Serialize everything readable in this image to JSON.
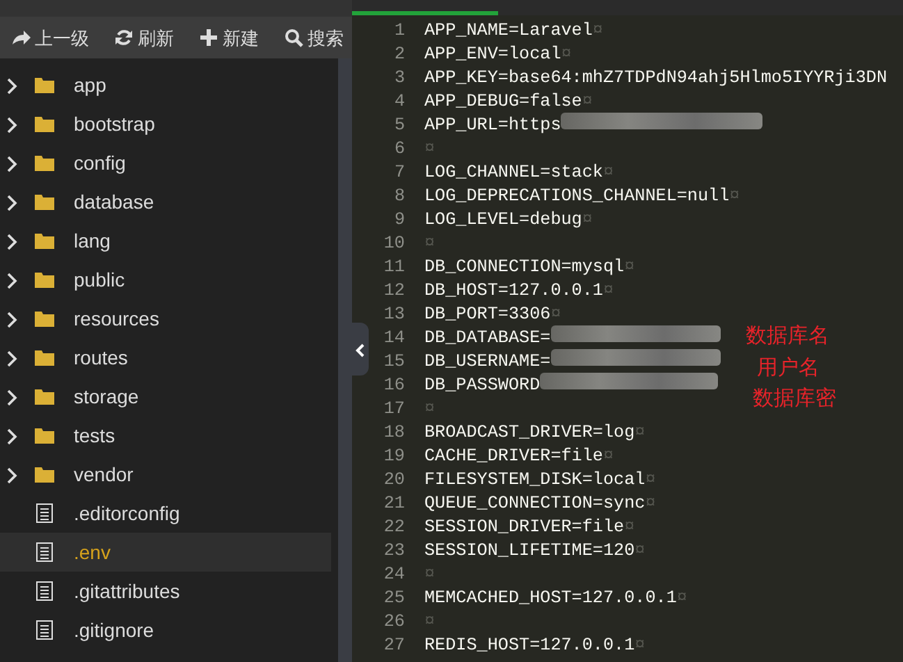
{
  "toolbar": [
    {
      "kind": "up",
      "label": "上一级"
    },
    {
      "kind": "refresh",
      "label": "刷新"
    },
    {
      "kind": "new",
      "label": "新建"
    },
    {
      "kind": "search",
      "label": "搜索"
    }
  ],
  "tree": [
    {
      "kind": "folder",
      "name": "app",
      "selected": false,
      "expanded": false
    },
    {
      "kind": "folder",
      "name": "bootstrap",
      "selected": false,
      "expanded": false
    },
    {
      "kind": "folder",
      "name": "config",
      "selected": false,
      "expanded": false
    },
    {
      "kind": "folder",
      "name": "database",
      "selected": false,
      "expanded": false
    },
    {
      "kind": "folder",
      "name": "lang",
      "selected": false,
      "expanded": false
    },
    {
      "kind": "folder",
      "name": "public",
      "selected": false,
      "expanded": false
    },
    {
      "kind": "folder",
      "name": "resources",
      "selected": false,
      "expanded": false
    },
    {
      "kind": "folder",
      "name": "routes",
      "selected": false,
      "expanded": false
    },
    {
      "kind": "folder",
      "name": "storage",
      "selected": false,
      "expanded": false
    },
    {
      "kind": "folder",
      "name": "tests",
      "selected": false,
      "expanded": false
    },
    {
      "kind": "folder",
      "name": "vendor",
      "selected": false,
      "expanded": false
    },
    {
      "kind": "file",
      "name": ".editorconfig",
      "selected": false
    },
    {
      "kind": "file",
      "name": ".env",
      "selected": true
    },
    {
      "kind": "file",
      "name": ".gitattributes",
      "selected": false
    },
    {
      "kind": "file",
      "name": ".gitignore",
      "selected": false
    }
  ],
  "editor": {
    "lines": [
      {
        "number": "1",
        "code": "APP_NAME=Laravel",
        "eol": "¤"
      },
      {
        "number": "2",
        "code": "APP_ENV=local",
        "eol": "¤"
      },
      {
        "number": "3",
        "code": "APP_KEY=base64:mhZ7TDPdN94ahj5Hlmo5IYYRji3DN"
      },
      {
        "number": "4",
        "code": "APP_DEBUG=false",
        "eol": "¤"
      },
      {
        "number": "5",
        "code": "APP_URL=https",
        "redacted": true
      },
      {
        "number": "6",
        "eol": "¤"
      },
      {
        "number": "7",
        "code": "LOG_CHANNEL=stack",
        "eol": "¤"
      },
      {
        "number": "8",
        "code": "LOG_DEPRECATIONS_CHANNEL=null",
        "eol": "¤"
      },
      {
        "number": "9",
        "code": "LOG_LEVEL=debug",
        "eol": "¤"
      },
      {
        "number": "10",
        "eol": "¤"
      },
      {
        "number": "11",
        "code": "DB_CONNECTION=mysql",
        "eol": "¤"
      },
      {
        "number": "12",
        "code": "DB_HOST=127.0.0.1",
        "eol": "¤"
      },
      {
        "number": "13",
        "code": "DB_PORT=3306",
        "eol": "¤"
      },
      {
        "number": "14",
        "code": "DB_DATABASE=",
        "redacted": true
      },
      {
        "number": "15",
        "code": "DB_USERNAME=",
        "redacted": true
      },
      {
        "number": "16",
        "code": "DB_PASSWORD",
        "redacted": true
      },
      {
        "number": "17",
        "eol": "¤"
      },
      {
        "number": "18",
        "code": "BROADCAST_DRIVER=log",
        "eol": "¤"
      },
      {
        "number": "19",
        "code": "CACHE_DRIVER=file",
        "eol": "¤"
      },
      {
        "number": "20",
        "code": "FILESYSTEM_DISK=local",
        "eol": "¤"
      },
      {
        "number": "21",
        "code": "QUEUE_CONNECTION=sync",
        "eol": "¤"
      },
      {
        "number": "22",
        "code": "SESSION_DRIVER=file",
        "eol": "¤"
      },
      {
        "number": "23",
        "code": "SESSION_LIFETIME=120",
        "eol": "¤"
      },
      {
        "number": "24",
        "eol": "¤"
      },
      {
        "number": "25",
        "code": "MEMCACHED_HOST=127.0.0.1",
        "eol": "¤"
      },
      {
        "number": "26",
        "eol": "¤"
      },
      {
        "number": "27",
        "code": "REDIS_HOST=127.0.0.1",
        "eol": "¤"
      }
    ],
    "notes": [
      "数据库名",
      "用户名",
      "数据库密"
    ]
  }
}
